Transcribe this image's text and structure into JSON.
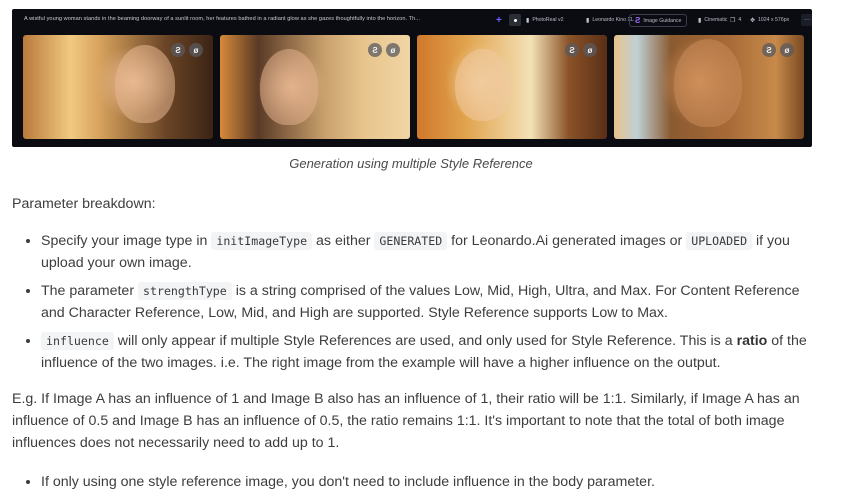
{
  "screenshot": {
    "prompt": "A wistful young woman stands in the beaming doorway of a sunlit room, her features bathed in a radiant glow as she gazes thoughtfully into the horizon. Th...",
    "toolbar": {
      "add_label": "+",
      "chips": [
        {
          "icon": "model-icon",
          "label": "PhotoReal v2"
        },
        {
          "icon": "model-icon",
          "label": "Leonardo Kino XL"
        },
        {
          "icon": "image-guidance-icon",
          "label": "Image Guidance"
        },
        {
          "icon": "style-icon",
          "label": "Cinematic"
        },
        {
          "icon": "images-icon",
          "label": "4"
        },
        {
          "icon": "dimensions-icon",
          "label": "1024 x 576px"
        }
      ],
      "more_label": "···"
    },
    "cards": [
      {
        "name": "generated-image-1",
        "remix_icon": "remix-icon",
        "hide_icon": "hide-icon"
      },
      {
        "name": "generated-image-2",
        "remix_icon": "remix-icon",
        "hide_icon": "hide-icon"
      },
      {
        "name": "generated-image-3",
        "remix_icon": "remix-icon",
        "hide_icon": "hide-icon"
      },
      {
        "name": "generated-image-4",
        "remix_icon": "remix-icon",
        "hide_icon": "hide-icon"
      }
    ]
  },
  "caption": "Generation using multiple Style Reference",
  "breakdown_heading": "Parameter breakdown:",
  "bullets": [
    {
      "pre": "Specify your image type in ",
      "code1": "initImageType",
      "mid": " as either ",
      "code2": "GENERATED",
      "mid2": " for Leonardo.Ai generated images or ",
      "code3": "UPLOADED",
      "post": " if you upload your own image."
    },
    {
      "pre": "The parameter ",
      "code1": "strengthType",
      "post": " is a string comprised of the values Low, Mid, High, Ultra, and Max. For Content Reference and Character Reference, Low, Mid, and High are supported. Style Reference supports Low to Max."
    },
    {
      "code1": "influence",
      "pre": " will only appear if multiple Style References are used, and only used for Style Reference. This is a ",
      "bold": "ratio",
      "post": " of the influence of the two images. i.e. The right image from the example will have a higher influence on the output."
    }
  ],
  "example_paragraph": "E.g. If Image A has an influence of 1 and Image B also has an influence of 1, their ratio will be 1:1. Similarly, if Image A has an influence of 0.5 and Image B has an influence of 0.5, the ratio remains 1:1. It's important to note that the total of both image influences does not necessarily need to add up to 1.",
  "final_bullet": "If only using one style reference image, you don't need to include influence in the body parameter."
}
